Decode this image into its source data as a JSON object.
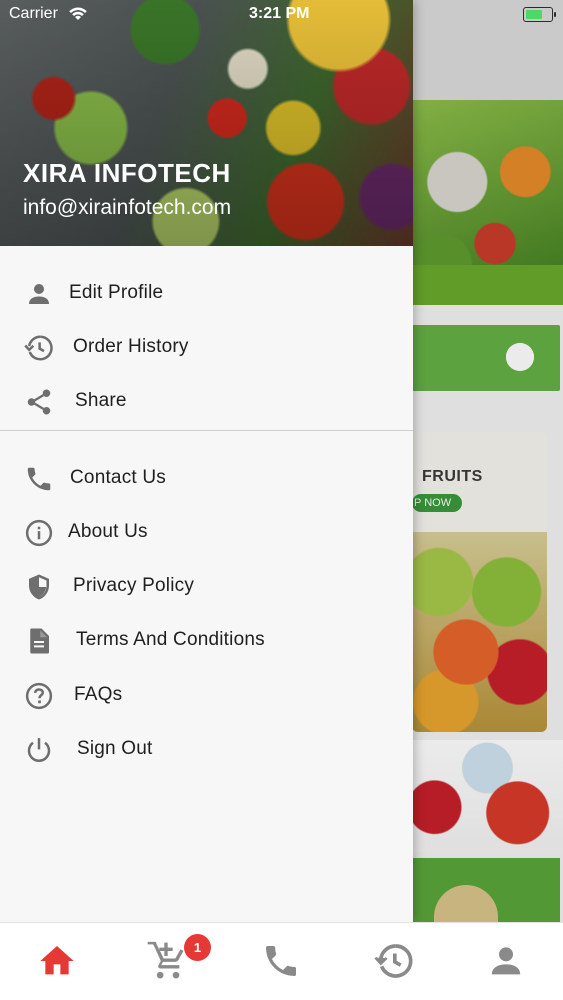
{
  "status_bar": {
    "carrier": "Carrier",
    "time": "3:21 PM",
    "battery_level": 0.65
  },
  "background": {
    "card_title": "FRUITS",
    "card_button": "P NOW"
  },
  "drawer": {
    "header": {
      "name": "XIRA INFOTECH",
      "email": "info@xirainfotech.com"
    },
    "items": [
      {
        "label": "Edit Profile",
        "icon": "person-icon"
      },
      {
        "label": "Order History",
        "icon": "history-icon"
      },
      {
        "label": "Share",
        "icon": "share-icon"
      },
      {
        "label": "Contact Us",
        "icon": "phone-icon"
      },
      {
        "label": "About Us",
        "icon": "info-icon"
      },
      {
        "label": "Privacy Policy",
        "icon": "shield-icon"
      },
      {
        "label": "Terms And Conditions",
        "icon": "document-icon"
      },
      {
        "label": "FAQs",
        "icon": "help-icon"
      },
      {
        "label": "Sign Out",
        "icon": "power-icon"
      }
    ]
  },
  "bottom_nav": {
    "items": [
      {
        "icon": "home-icon",
        "active": true
      },
      {
        "icon": "cart-add-icon",
        "badge": "1"
      },
      {
        "icon": "phone-icon"
      },
      {
        "icon": "history-icon"
      },
      {
        "icon": "person-icon"
      }
    ],
    "active_color": "#e53935",
    "inactive_color": "#8a8a8a"
  },
  "colors": {
    "accent": "#e53935",
    "icon_gray": "#6e6e6e",
    "drawer_bg": "#f7f7f8"
  }
}
